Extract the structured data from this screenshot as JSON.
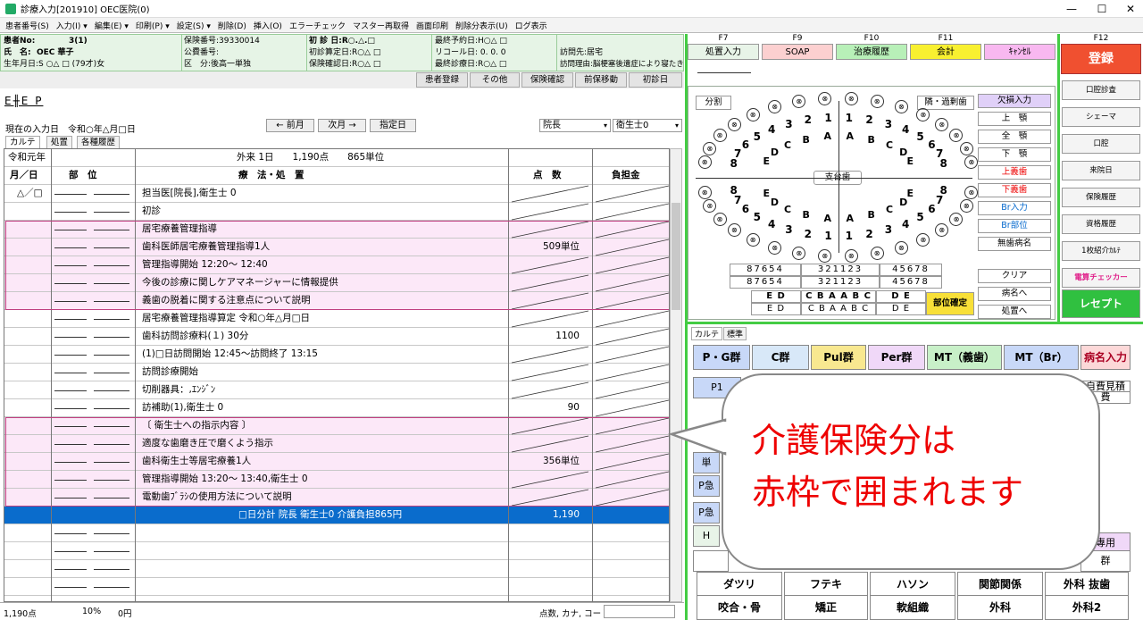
{
  "window": {
    "title": "診療入力[201910] OEC医院(0)",
    "min": "—",
    "max": "☐",
    "close": "✕"
  },
  "menu": [
    "患者番号(S)",
    "入力(I) ▾",
    "編集(E) ▾",
    "印刷(P) ▾",
    "設定(S) ▾",
    "削除(D)",
    "挿入(O)",
    "エラーチェック",
    "マスター再取得",
    "画面印刷",
    "削除分表示(U)",
    "ログ表示"
  ],
  "patient": {
    "no_label": "患者No:",
    "no_value": "3(1)",
    "name_label": "氏　名:",
    "name_value": "OEC 華子",
    "dob": "生年月日:S ○△ □ (79才)女",
    "insurer": "保険番号:39330014",
    "public": "公費番号:",
    "category": "区　分:後高一単独",
    "first_visit": "初 診 日:R○.△.□",
    "first_calc": "初診算定日:R○△ □",
    "ins_check": "保険確認日:R○△ □",
    "last_appt": "最終予約日:H○△ □",
    "recall": "リコール日: 0. 0. 0",
    "last_visit": "最終診療日:R○△ □",
    "visit_to": "訪問先:居宅",
    "visit_reason": "訪問理由:脳梗塞後遺症により寝たきりのため"
  },
  "actions": [
    "患者登録",
    "その他",
    "保険確認",
    "前保移動",
    "初診日"
  ],
  "etep": "E╫E P",
  "date_line": "現在の入力日　令和○年△月□日",
  "nav": {
    "prev": "← 前月",
    "next": "次月 →",
    "set": "指定日"
  },
  "doctor_select": "院長",
  "hygienist_select": "衛生士0",
  "tabs": [
    "カルテ",
    "処置",
    "各種履歴"
  ],
  "sheet": {
    "era": "令和元年",
    "summary": "外来 1日　　1,190点　　865単位",
    "headers": {
      "date": "月／日",
      "site": "部　位",
      "treatment": "療　法・処　置",
      "points": "点　数",
      "burden": "負担金"
    },
    "rows": [
      {
        "date": "△／□",
        "text": "担当医[院長],衛生士 0",
        "points": ""
      },
      {
        "date": "",
        "text": "初診",
        "points": ""
      },
      {
        "date": "",
        "text": "居宅療養管理指導",
        "points": ""
      },
      {
        "date": "",
        "text": "歯科医師居宅療養管理指導1人",
        "points": "509単位"
      },
      {
        "date": "",
        "text": "管理指導開始 12:20～ 12:40",
        "points": ""
      },
      {
        "date": "",
        "text": "今後の診療に関しケアマネージャーに情報提供",
        "points": ""
      },
      {
        "date": "",
        "text": "義歯の脱着に関する注意点について説明",
        "points": ""
      },
      {
        "date": "",
        "text": "居宅療養管理指導算定 令和○年△月□日",
        "points": ""
      },
      {
        "date": "",
        "text": "歯科訪問診療料(１) 30分",
        "points": "1100"
      },
      {
        "date": "",
        "text": "(1)□日訪問開始 12:45～訪問終了 13:15",
        "points": ""
      },
      {
        "date": "",
        "text": "訪問診療開始",
        "points": ""
      },
      {
        "date": "",
        "text": "切削器具：,ｴﾝｼﾞﾝ",
        "points": ""
      },
      {
        "date": "",
        "text": "訪補助(1),衛生士 0",
        "points": "90"
      },
      {
        "date": "",
        "text": "〔 衛生士への指示内容 〕",
        "points": ""
      },
      {
        "date": "",
        "text": "適度な歯磨き圧で磨くよう指示",
        "points": ""
      },
      {
        "date": "",
        "text": "歯科衛生士等居宅療養1人",
        "points": "356単位"
      },
      {
        "date": "",
        "text": "管理指導開始 13:20～ 13:40,衛生士 0",
        "points": ""
      },
      {
        "date": "",
        "text": "電動歯ﾌﾞﾗｼの使用方法について説明",
        "points": ""
      }
    ],
    "total_row": {
      "text": "□日分計 院長 衛生士0 介護負担865円",
      "points": "1,190"
    }
  },
  "status": {
    "points": "1,190点",
    "ratio": "10%",
    "yen": "0円",
    "search_label": "点数, カナ, コード"
  },
  "fkeys": [
    {
      "key": "F7",
      "label": "処置入力",
      "color": "#e8f4e8"
    },
    {
      "key": "F9",
      "label": "SOAP",
      "color": "#fcd0d0"
    },
    {
      "key": "F10",
      "label": "治療履歴",
      "color": "#b8f0b8"
    },
    {
      "key": "F11",
      "label": "会計",
      "color": "#f8f030"
    },
    {
      "key": "",
      "label": "ｷｬﾝｾﾙ",
      "color": "#f8b8f0"
    }
  ],
  "f12": {
    "key": "F12",
    "label": "登録"
  },
  "dental": {
    "bunkatsu": "分割",
    "rinsetsu": "隣・過剰歯",
    "support": "支台歯",
    "side_buttons": [
      "欠損入力",
      "上　顎",
      "全　顎",
      "下　顎",
      "上義歯",
      "下義歯",
      "Br入力",
      "Br部位",
      "無歯病名",
      "クリア",
      "病名へ",
      "処置へ"
    ],
    "upper_nums": [
      "8",
      "7",
      "6",
      "5",
      "4",
      "3",
      "2",
      "1",
      "1",
      "2",
      "3",
      "4",
      "5",
      "6",
      "7",
      "8"
    ],
    "milk": [
      "E",
      "D",
      "C",
      "B",
      "A",
      "A",
      "B",
      "C",
      "D",
      "E"
    ],
    "grid_row1": [
      "87654",
      "321123",
      "45678"
    ],
    "grid_row2": [
      "87654",
      "321123",
      "45678"
    ],
    "grid_row3": [
      "E D",
      "C B A A B C",
      "D E"
    ],
    "grid_row4": [
      "E D",
      "C B A A B C",
      "D E"
    ],
    "confirm": "部位確定"
  },
  "right_buttons": [
    "口腔診査",
    "シェーマ",
    "口腔",
    "来院日",
    "保険履歴",
    "資格履歴",
    "1枚紹介ｶﾙﾃ",
    "電算チェッカー",
    "レセプト"
  ],
  "karte": {
    "tabs": [
      "カルテ",
      "標準"
    ],
    "row1": [
      "P・G群",
      "C群",
      "Pul群",
      "Per群",
      "MT（義歯）",
      "MT（Br）",
      "病名入力"
    ],
    "partial": [
      "P1",
      "自費見積",
      "費",
      "単",
      "P急",
      "P急発",
      "H",
      "專用",
      "群"
    ],
    "bottom1": [
      "ダツリ",
      "フテキ",
      "ハソン",
      "関節関係",
      "外科 抜歯"
    ],
    "bottom2": [
      "咬合・骨",
      "矯正",
      "軟組織",
      "外科",
      "外科2"
    ]
  },
  "callout": {
    "line1": "介護保険分は",
    "line2": "赤枠で囲まれます"
  }
}
